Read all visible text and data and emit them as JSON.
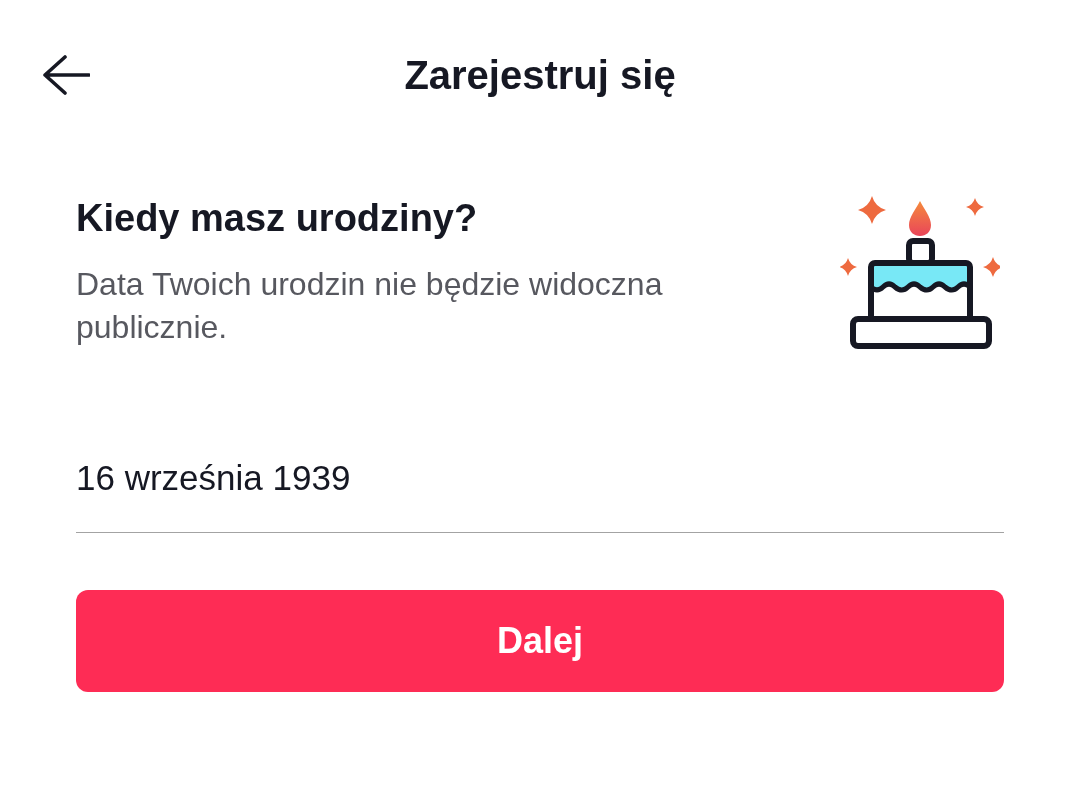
{
  "header": {
    "title": "Zarejestruj się"
  },
  "question": {
    "title": "Kiedy masz urodziny?",
    "subtitle": "Data Twoich urodzin nie będzie widoczna publicznie."
  },
  "birthday_field": {
    "value": "16 września 1939"
  },
  "next_button": {
    "label": "Dalej"
  }
}
